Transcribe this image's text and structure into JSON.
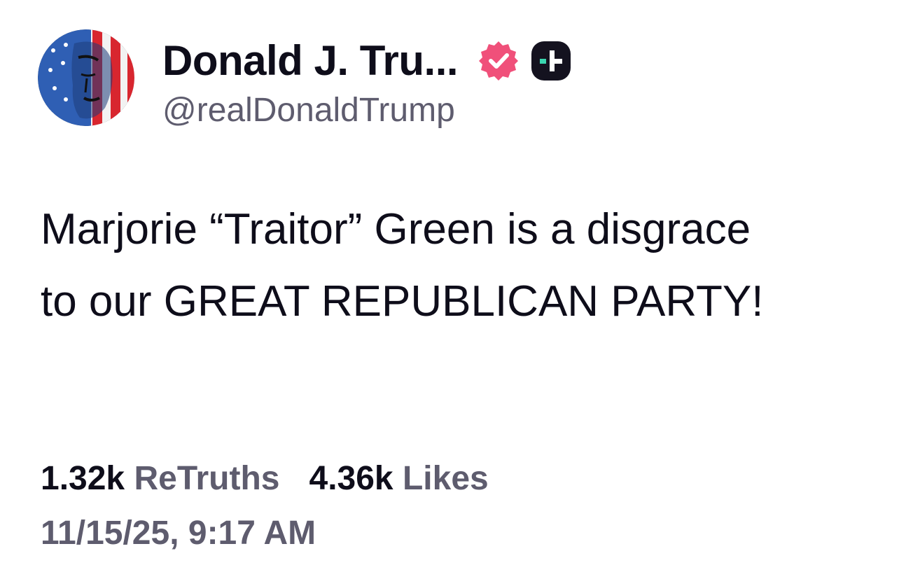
{
  "author": {
    "display_name": "Donald J. Tru...",
    "handle": "@realDonaldTrump",
    "avatar_icon": "flag-portrait-avatar",
    "verified_icon": "verified-badge-icon",
    "platform_badge_icon": "truth-plus-badge-icon"
  },
  "post": {
    "text": "Marjorie “Traitor” Green is a disgrace to our GREAT REPUBLICAN PARTY!"
  },
  "stats": {
    "retruths_count": "1.32k",
    "retruths_label": "ReTruths",
    "likes_count": "4.36k",
    "likes_label": "Likes"
  },
  "timestamp": "11/15/25, 9:17 AM",
  "colors": {
    "text_primary": "#0e0d1a",
    "text_secondary": "#5e5c6e",
    "verified_pink": "#f0507a",
    "badge_dark": "#14121f",
    "badge_teal": "#3ad6b0"
  }
}
